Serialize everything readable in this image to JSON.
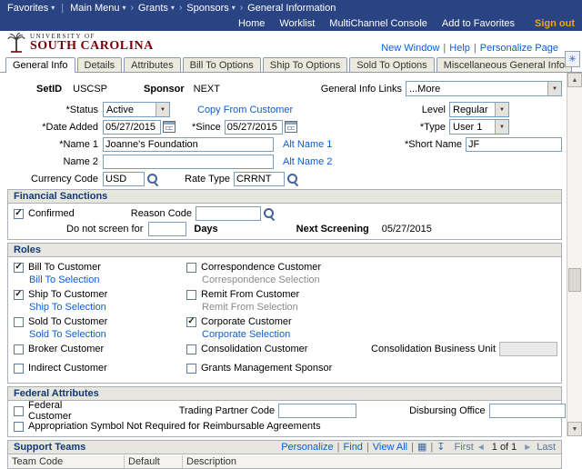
{
  "icons": {
    "grid": "▦",
    "download": "↧",
    "prev": "◄",
    "next": "►",
    "processing": "✳"
  },
  "header": {
    "breadcrumb": {
      "favorites": "Favorites",
      "main_menu": "Main Menu",
      "grants": "Grants",
      "sponsors": "Sponsors",
      "current": "General Information"
    },
    "links": [
      "Home",
      "Worklist",
      "MultiChannel Console",
      "Add to Favorites"
    ],
    "signout": "Sign out",
    "brand_line1": "UNIVERSITY OF",
    "brand_line2": "SOUTH CAROLINA",
    "page_links": [
      "New Window",
      "Help",
      "Personalize Page"
    ]
  },
  "tabs": [
    {
      "label": "General Info"
    },
    {
      "label": "Details"
    },
    {
      "label": "Attributes"
    },
    {
      "label": "Bill To Options"
    },
    {
      "label": "Ship To Options"
    },
    {
      "label": "Sold To Options"
    },
    {
      "label": "Miscellaneous General Info"
    }
  ],
  "form": {
    "setid_label": "SetID",
    "setid_value": "USCSP",
    "sponsor_label": "Sponsor",
    "sponsor_value": "NEXT",
    "general_info_links_label": "General Info Links",
    "general_info_links_value": "...More",
    "status_label": "*Status",
    "status_value": "Active",
    "copy_from_customer": "Copy From Customer",
    "level_label": "Level",
    "level_value": "Regular",
    "date_added_label": "*Date Added",
    "date_added_value": "05/27/2015",
    "since_label": "*Since",
    "since_value": "05/27/2015",
    "type_label": "*Type",
    "type_value": "User 1",
    "name1_label": "*Name 1",
    "name1_value": "Joanne's Foundation",
    "alt_name1": "Alt Name 1",
    "short_name_label": "*Short Name",
    "short_name_value": "JF",
    "name2_label": "Name 2",
    "name2_value": "",
    "alt_name2": "Alt Name 2",
    "currency_label": "Currency Code",
    "currency_value": "USD",
    "rate_type_label": "Rate Type",
    "rate_type_value": "CRRNT"
  },
  "financial_sanctions": {
    "title": "Financial Sanctions",
    "confirmed_label": "Confirmed",
    "confirmed_checked": true,
    "reason_code_label": "Reason Code",
    "reason_code_value": "",
    "do_not_screen_label": "Do not screen for",
    "do_not_screen_value": "",
    "days_label": "Days",
    "next_screening_label": "Next Screening",
    "next_screening_value": "05/27/2015"
  },
  "roles": {
    "title": "Roles",
    "left": [
      {
        "label": "Bill To Customer",
        "checked": true,
        "link": "Bill To Selection"
      },
      {
        "label": "Ship To Customer",
        "checked": true,
        "link": "Ship To Selection"
      },
      {
        "label": "Sold To Customer",
        "checked": false,
        "link": "Sold To Selection"
      },
      {
        "label": "Broker Customer",
        "checked": false
      },
      {
        "label": "Indirect Customer",
        "checked": false
      }
    ],
    "right": [
      {
        "label": "Correspondence Customer",
        "checked": false,
        "link": "Correspondence Selection",
        "link_enabled": false
      },
      {
        "label": "Remit From Customer",
        "checked": false,
        "link": "Remit From Selection",
        "link_enabled": false
      },
      {
        "label": "Corporate Customer",
        "checked": true,
        "link": "Corporate Selection",
        "link_enabled": true
      },
      {
        "label": "Consolidation Customer",
        "checked": false
      },
      {
        "label": "Grants Management Sponsor",
        "checked": false
      }
    ],
    "consolidation_bu_label": "Consolidation Business Unit",
    "consolidation_bu_value": ""
  },
  "federal_attributes": {
    "title": "Federal Attributes",
    "federal_customer_label": "Federal Customer",
    "federal_customer_checked": false,
    "trading_partner_label": "Trading Partner Code",
    "trading_partner_value": "",
    "disbursing_office_label": "Disbursing Office",
    "disbursing_office_value": "",
    "appropriation_label": "Appropriation Symbol Not Required for Reimbursable Agreements",
    "appropriation_checked": false
  },
  "support_teams": {
    "title": "Support Teams",
    "toolbar": {
      "personalize": "Personalize",
      "find": "Find",
      "view_all": "View All",
      "first": "First",
      "page": "1 of 1",
      "last": "Last"
    },
    "columns": [
      "Team Code",
      "Default",
      "Description"
    ]
  }
}
